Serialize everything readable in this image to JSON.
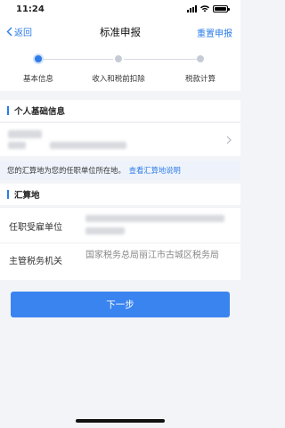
{
  "status_bar": {
    "time": "11:24"
  },
  "nav": {
    "back_label": "返回",
    "title": "标准申报",
    "reset_label": "重置申报"
  },
  "steps": [
    {
      "label": "基本信息",
      "active": true
    },
    {
      "label": "收入和税前扣除",
      "active": false
    },
    {
      "label": "税款计算",
      "active": false
    }
  ],
  "personal_section": {
    "title": "个人基础信息"
  },
  "notice": {
    "text": "您的汇算地为您的任职单位所在地。",
    "link": "查看汇算地说明"
  },
  "settlement_section": {
    "title": "汇算地",
    "employer_label": "任职受雇单位",
    "tax_authority_label": "主管税务机关",
    "tax_authority_value": "国家税务总局丽江市古城区税务局"
  },
  "next_button": {
    "label": "下一步"
  },
  "colors": {
    "accent": "#2d7ce8",
    "button": "#3a84f0"
  }
}
